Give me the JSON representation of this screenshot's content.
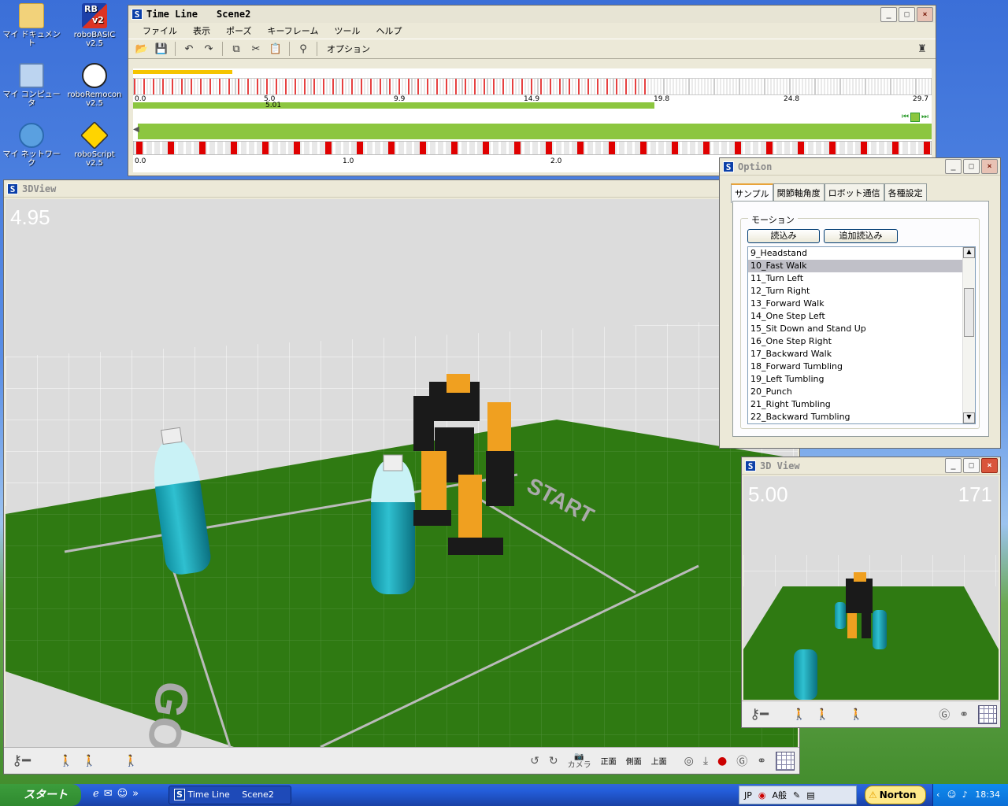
{
  "desktop": {
    "icons": [
      {
        "label": "マイ ドキュメント"
      },
      {
        "label": "roboBASIC v2.5"
      },
      {
        "label": "マイ コンピュータ"
      },
      {
        "label": "roboRemocon v2.5"
      },
      {
        "label": "マイ ネットワーク"
      },
      {
        "label": "roboScript v2.5"
      }
    ],
    "rb_badge": "RB",
    "v2_badge": "v2"
  },
  "timeline": {
    "title": "Time Line",
    "scene": "Scene2",
    "menu": [
      "ファイル",
      "表示",
      "ポーズ",
      "キーフレーム",
      "ツール",
      "ヘルプ"
    ],
    "options_label": "オプション",
    "ruler1": [
      "0.0",
      "5.0",
      "9.9",
      "14.9",
      "19.8",
      "24.8",
      "29.7"
    ],
    "marker_value": "5.01",
    "ruler2": [
      "0.0",
      "1.0",
      "2.0"
    ]
  },
  "view_main": {
    "title": "3DView",
    "time": "4.95",
    "floor_texts": [
      "GOAL",
      "START"
    ],
    "toolbar": {
      "camera": "カメラ",
      "front": "正面",
      "side": "側面",
      "top": "上面"
    }
  },
  "option": {
    "title": "Option",
    "tabs": [
      "サンプル",
      "関節軸角度",
      "ロボット通信",
      "各種設定"
    ],
    "group_label": "モーション",
    "load_button": "読込み",
    "add_load_button": "追加読込み",
    "list": [
      "9_Headstand",
      "10_Fast Walk",
      "11_Turn Left",
      "12_Turn Right",
      "13_Forward Walk",
      "14_One Step Left",
      "15_Sit Down and Stand Up",
      "16_One Step Right",
      "17_Backward Walk",
      "18_Forward Tumbling",
      "19_Left Tumbling",
      "20_Punch",
      "21_Right Tumbling",
      "22_Backward Tumbling"
    ],
    "selected_index": 1
  },
  "view_small": {
    "title": "3D View",
    "time": "5.00",
    "frame": "171"
  },
  "taskbar": {
    "start": "スタート",
    "task_title": "Time Line",
    "task_scene": "Scene2",
    "lang": "JP",
    "ime": "A般",
    "norton": "Norton",
    "clock": "18:34"
  },
  "colors": {
    "accent_yellow": "#f5c400",
    "timeline_green": "#8cc63f",
    "keyframe_red": "#e00000",
    "floor_green": "#2f7a12"
  }
}
